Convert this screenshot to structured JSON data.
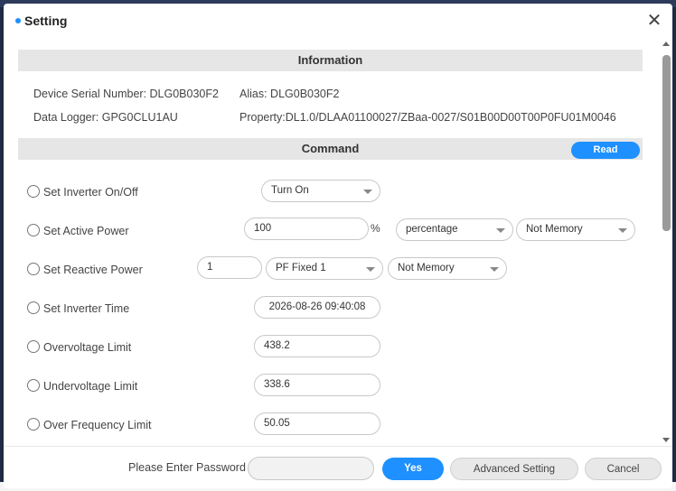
{
  "dialog": {
    "title": "Setting",
    "close_icon": "close-icon"
  },
  "information": {
    "heading": "Information",
    "serial_text": "Device Serial Number:  DLG0B030F2",
    "alias_text": "Alias:  DLG0B030F2",
    "logger_text": "Data Logger:  GPG0CLU1AU",
    "property_text": "Property:DL1.0/DLAA01100027/ZBaa-0027/S01B00D00T00P0FU01M0046"
  },
  "command": {
    "heading": "Command",
    "read_label": "Read",
    "rows": {
      "inverter_onoff": {
        "label": "Set Inverter On/Off",
        "select": "Turn On"
      },
      "active_power": {
        "label": "Set Active Power",
        "value": "100",
        "unit": "%",
        "mode": "percentage",
        "memory": "Not Memory"
      },
      "reactive_power": {
        "label": "Set Reactive Power",
        "value": "1",
        "mode": "PF Fixed 1",
        "memory": "Not Memory"
      },
      "inverter_time": {
        "label": "Set Inverter Time",
        "value": "2026-08-26 09:40:08"
      },
      "overvoltage": {
        "label": "Overvoltage Limit",
        "value": "438.2"
      },
      "undervoltage": {
        "label": "Undervoltage Limit",
        "value": "338.6"
      },
      "over_frequency": {
        "label": "Over Frequency Limit",
        "value": "50.05"
      }
    }
  },
  "footer": {
    "password_label": "Please Enter Password",
    "password_value": "",
    "yes_label": "Yes",
    "advanced_label": "Advanced Setting",
    "cancel_label": "Cancel"
  },
  "colors": {
    "accent": "#1e90ff",
    "section_bg": "#e6e6e6"
  }
}
